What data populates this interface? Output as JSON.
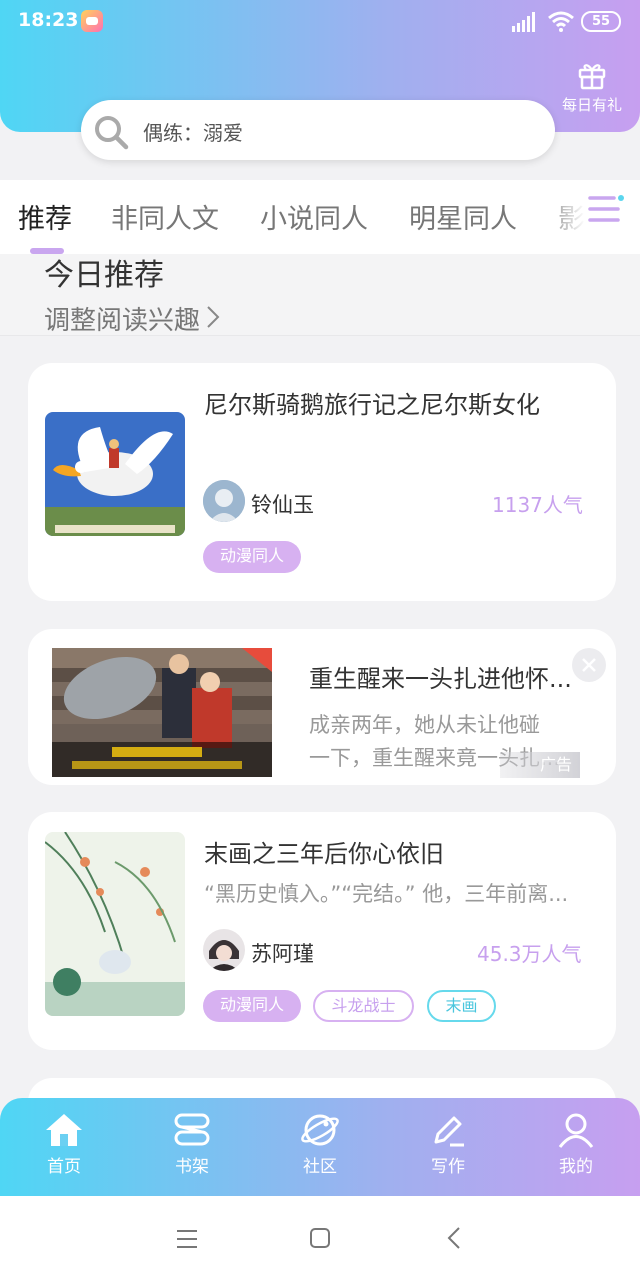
{
  "status": {
    "time": "18:23",
    "battery": "55"
  },
  "header": {
    "gift_label": "每日有礼",
    "search_placeholder": "偶练：溺爱"
  },
  "tabs": [
    {
      "label": "推荐"
    },
    {
      "label": "非同人文"
    },
    {
      "label": "小说同人"
    },
    {
      "label": "明星同人"
    },
    {
      "label": "影视"
    }
  ],
  "section": {
    "title": "今日推荐",
    "subtitle": "调整阅读兴趣"
  },
  "cards": [
    {
      "title": "尼尔斯骑鹅旅行记之尼尔斯女化",
      "author": "铃仙玉",
      "popularity": "1137人气",
      "tags": [
        "动漫同人"
      ]
    },
    {
      "title": "重生醒来一头扎进他怀...",
      "desc_line1": "成亲两年，她从未让他碰",
      "desc_line2": "一下，重生醒来竟一头扎...",
      "ad_label": "广告"
    },
    {
      "title": "末画之三年后你心依旧",
      "desc": "“黑历史慎入。”“完结。” 他，三年前离...",
      "author": "苏阿瑾",
      "popularity": "45.3万人气",
      "tags": [
        "动漫同人",
        "斗龙战士",
        "末画"
      ]
    }
  ],
  "bottom_nav": [
    {
      "label": "首页",
      "icon": "home-icon"
    },
    {
      "label": "书架",
      "icon": "bookshelf-icon"
    },
    {
      "label": "社区",
      "icon": "planet-icon"
    },
    {
      "label": "写作",
      "icon": "pen-icon"
    },
    {
      "label": "我的",
      "icon": "user-icon"
    }
  ],
  "colors": {
    "accent": "#c7a0ee",
    "gradient_start": "#4fd6f4",
    "gradient_end": "#c79ff0",
    "cyan_tag": "#49c6dd"
  }
}
